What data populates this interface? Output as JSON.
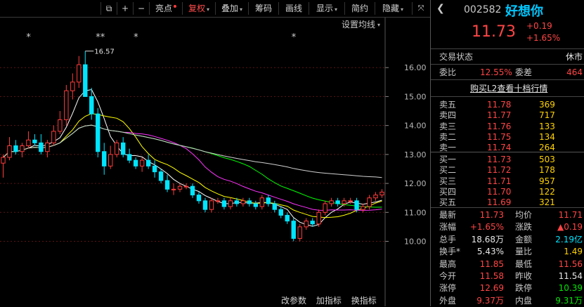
{
  "toolbar": {
    "items": [
      {
        "label": "亮点",
        "has_dot": true
      },
      {
        "label": "复权",
        "has_arrow": true,
        "active": true
      },
      {
        "label": "叠加",
        "has_arrow": true
      },
      {
        "label": "筹码"
      },
      {
        "label": "画线"
      },
      {
        "label": "显示",
        "has_arrow": true
      },
      {
        "label": "简约"
      },
      {
        "label": "隐藏",
        "has_arrow": true
      }
    ]
  },
  "chart": {
    "settings_label": "设置均线",
    "max_label": "16.57",
    "y_ticks": [
      "16.00",
      "15.00",
      "14.00",
      "13.00",
      "12.00",
      "11.00",
      "10.00"
    ],
    "markers": [
      "*",
      "**",
      "*",
      "*"
    ],
    "bottom_tabs": [
      "改参数",
      "加指标",
      "换指标"
    ]
  },
  "chart_data": {
    "type": "candlestick",
    "ylim": [
      9.6,
      17.0
    ],
    "candles": [
      [
        12.7,
        13.0,
        12.2,
        12.9
      ],
      [
        12.9,
        13.6,
        12.8,
        13.3
      ],
      [
        13.3,
        13.5,
        13.0,
        13.1
      ],
      [
        13.1,
        13.4,
        12.9,
        13.3
      ],
      [
        13.3,
        13.8,
        13.2,
        13.5
      ],
      [
        13.5,
        13.7,
        13.3,
        13.4
      ],
      [
        13.4,
        13.7,
        13.0,
        13.1
      ],
      [
        13.1,
        13.5,
        12.9,
        13.4
      ],
      [
        13.4,
        14.0,
        13.3,
        13.8
      ],
      [
        13.8,
        14.5,
        13.7,
        14.2
      ],
      [
        14.2,
        15.4,
        14.0,
        15.2
      ],
      [
        15.2,
        15.8,
        14.9,
        15.5
      ],
      [
        15.5,
        16.4,
        15.3,
        16.1
      ],
      [
        16.1,
        16.57,
        15.0,
        15.0
      ],
      [
        15.0,
        15.3,
        14.2,
        14.4
      ],
      [
        14.4,
        14.6,
        12.9,
        13.1
      ],
      [
        13.1,
        13.4,
        12.3,
        12.6
      ],
      [
        12.6,
        13.3,
        12.5,
        13.0
      ],
      [
        13.0,
        13.5,
        12.9,
        13.4
      ],
      [
        13.4,
        13.6,
        12.9,
        13.0
      ],
      [
        13.0,
        13.2,
        12.7,
        12.8
      ],
      [
        12.8,
        12.9,
        12.5,
        12.6
      ],
      [
        12.6,
        12.9,
        12.4,
        12.8
      ],
      [
        12.8,
        13.0,
        12.5,
        12.6
      ],
      [
        12.6,
        12.8,
        12.2,
        12.4
      ],
      [
        12.4,
        12.5,
        12.0,
        12.1
      ],
      [
        12.1,
        12.3,
        11.7,
        11.8
      ],
      [
        11.8,
        12.0,
        11.6,
        11.8
      ],
      [
        11.8,
        12.0,
        11.7,
        11.9
      ],
      [
        11.9,
        12.0,
        11.8,
        11.9
      ],
      [
        11.9,
        12.0,
        11.5,
        11.6
      ],
      [
        11.6,
        11.7,
        11.3,
        11.4
      ],
      [
        11.4,
        11.5,
        11.0,
        11.1
      ],
      [
        11.1,
        11.5,
        11.0,
        11.4
      ],
      [
        11.4,
        11.5,
        11.3,
        11.4
      ],
      [
        11.4,
        11.5,
        11.1,
        11.2
      ],
      [
        11.2,
        11.5,
        11.1,
        11.4
      ],
      [
        11.4,
        11.5,
        11.2,
        11.3
      ],
      [
        11.3,
        11.5,
        11.2,
        11.4
      ],
      [
        11.4,
        11.5,
        11.2,
        11.3
      ],
      [
        11.3,
        11.4,
        11.1,
        11.2
      ],
      [
        11.2,
        11.6,
        11.1,
        11.5
      ],
      [
        11.5,
        11.6,
        11.2,
        11.3
      ],
      [
        11.3,
        11.4,
        11.0,
        11.1
      ],
      [
        11.1,
        11.2,
        10.8,
        10.9
      ],
      [
        10.9,
        11.0,
        10.6,
        10.7
      ],
      [
        10.7,
        10.8,
        10.0,
        10.1
      ],
      [
        10.1,
        10.6,
        10.0,
        10.5
      ],
      [
        10.5,
        10.8,
        10.4,
        10.7
      ],
      [
        10.7,
        10.8,
        10.5,
        10.6
      ],
      [
        10.6,
        11.1,
        10.5,
        11.0
      ],
      [
        11.0,
        11.4,
        10.9,
        11.3
      ],
      [
        11.3,
        11.5,
        11.2,
        11.4
      ],
      [
        11.4,
        11.5,
        11.2,
        11.3
      ],
      [
        11.3,
        11.5,
        11.2,
        11.4
      ],
      [
        11.4,
        11.5,
        11.3,
        11.4
      ],
      [
        11.4,
        11.5,
        11.0,
        11.1
      ],
      [
        11.1,
        11.3,
        11.0,
        11.2
      ],
      [
        11.2,
        11.6,
        11.1,
        11.5
      ],
      [
        11.5,
        11.7,
        11.4,
        11.6
      ],
      [
        11.6,
        11.8,
        11.5,
        11.7
      ]
    ],
    "ma_colors": [
      "#ffffff",
      "#ffff00",
      "#ff33ff",
      "#00ff00",
      "#d0d0d0"
    ]
  },
  "quote": {
    "code": "002582",
    "name": "好想你",
    "price": "11.73",
    "change": "+0.19",
    "change_pct": "+1.65%",
    "trade_status_label": "交易状态",
    "trade_status_value": "休市",
    "weibi_label": "委比",
    "weibi_value": "12.55%",
    "weicha_label": "委差",
    "weicha_value": "464",
    "l2_link": "购买L2查看十档行情",
    "asks": [
      {
        "label": "卖五",
        "price": "11.78",
        "vol": "369"
      },
      {
        "label": "卖四",
        "price": "11.77",
        "vol": "717"
      },
      {
        "label": "卖三",
        "price": "11.76",
        "vol": "133"
      },
      {
        "label": "卖二",
        "price": "11.75",
        "vol": "134"
      },
      {
        "label": "卖一",
        "price": "11.74",
        "vol": "264"
      }
    ],
    "bids": [
      {
        "label": "买一",
        "price": "11.73",
        "vol": "503"
      },
      {
        "label": "买二",
        "price": "11.72",
        "vol": "178"
      },
      {
        "label": "买三",
        "price": "11.71",
        "vol": "957"
      },
      {
        "label": "买四",
        "price": "11.70",
        "vol": "122"
      },
      {
        "label": "买五",
        "price": "11.69",
        "vol": "321"
      }
    ],
    "stats": [
      {
        "l1": "最新",
        "v1": "11.73",
        "c1": "red",
        "l2": "均价",
        "v2": "11.71",
        "c2": "red"
      },
      {
        "l1": "涨幅",
        "v1": "+1.65%",
        "c1": "red",
        "l2": "涨跌",
        "v2": "▲0.19",
        "c2": "red"
      },
      {
        "l1": "总手",
        "v1": "18.68万",
        "c1": "white",
        "l2": "金额",
        "v2": "2.19亿",
        "c2": "cyan"
      },
      {
        "l1": "换手*",
        "v1": "5.43%",
        "c1": "white",
        "l2": "量比",
        "v2": "1.49",
        "c2": "yellow"
      },
      {
        "l1": "最高",
        "v1": "11.85",
        "c1": "red",
        "l2": "最低",
        "v2": "11.56",
        "c2": "red"
      },
      {
        "l1": "今开",
        "v1": "11.58",
        "c1": "red",
        "l2": "昨收",
        "v2": "11.54",
        "c2": "white"
      },
      {
        "l1": "涨停",
        "v1": "12.69",
        "c1": "red",
        "l2": "跌停",
        "v2": "10.39",
        "c2": "green"
      },
      {
        "l1": "外盘",
        "v1": "9.37万",
        "c1": "red",
        "l2": "内盘",
        "v2": "9.31万",
        "c2": "green"
      }
    ]
  }
}
